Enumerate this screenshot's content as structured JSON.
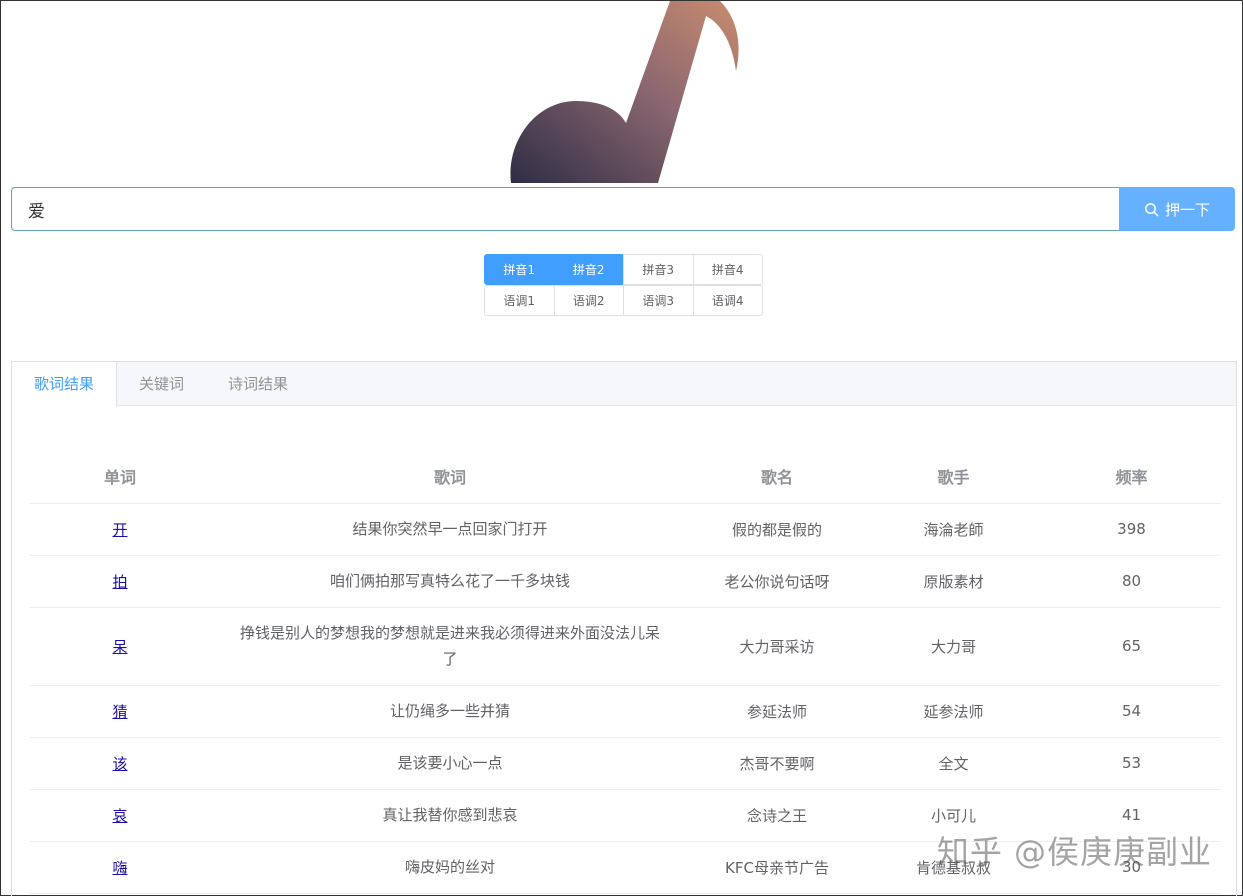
{
  "search": {
    "value": "爱",
    "button_label": "押一下"
  },
  "pinyin_options": [
    "拼音1",
    "拼音2",
    "拼音3",
    "拼音4"
  ],
  "tone_options": [
    "语调1",
    "语调2",
    "语调3",
    "语调4"
  ],
  "tabs": [
    "歌词结果",
    "关键词",
    "诗词结果"
  ],
  "table": {
    "headers": [
      "单词",
      "歌词",
      "歌名",
      "歌手",
      "频率"
    ],
    "rows": [
      [
        "开",
        "结果你突然早一点回家门打开",
        "假的都是假的",
        "海淪老師",
        "398"
      ],
      [
        "拍",
        "咱们俩拍那写真特么花了一千多块钱",
        "老公你说句话呀",
        "原版素材",
        "80"
      ],
      [
        "呆",
        "挣钱是别人的梦想我的梦想就是进来我必须得进来外面没法儿呆了",
        "大力哥采访",
        "大力哥",
        "65"
      ],
      [
        "猜",
        "让仍绳多一些并猜",
        "参延法师",
        "延参法师",
        "54"
      ],
      [
        "该",
        "是该要小心一点",
        "杰哥不要啊",
        "全文",
        "53"
      ],
      [
        "哀",
        "真让我替你感到悲哀",
        "念诗之王",
        "小可儿",
        "41"
      ],
      [
        "嗨",
        "嗨皮妈的丝对",
        "KFC母亲节广告",
        "肯德基叔叔",
        "30"
      ]
    ]
  },
  "watermark": "知乎 @侯庚庚副业",
  "colors": {
    "primary": "#409eff",
    "button": "#66b1ff"
  },
  "icons": {
    "search_button": "search-icon",
    "logo": "music-note-icon"
  }
}
